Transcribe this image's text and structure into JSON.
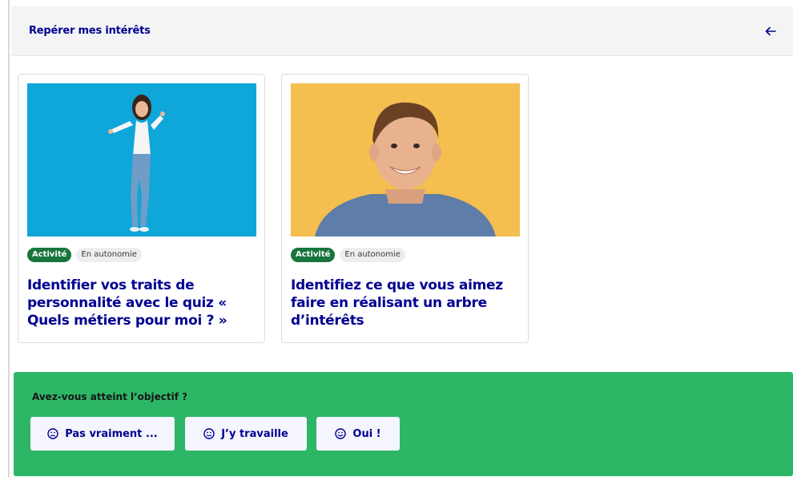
{
  "header": {
    "title": "Repérer mes intérêts",
    "back_icon": "arrow-left-icon"
  },
  "cards": [
    {
      "image": "girl-blue-background-photo",
      "badges": [
        "Activité",
        "En autonomie"
      ],
      "title": "Identifier vos traits de personnalité avec le quiz « Quels métiers pour moi ? »"
    },
    {
      "image": "boy-yellow-background-photo",
      "badges": [
        "Activité",
        "En autonomie"
      ],
      "title": "Identifiez ce que vous aimez faire en réalisant un arbre d’intérêts"
    }
  ],
  "feedback": {
    "question": "Avez-vous atteint l’objectif ?",
    "options": [
      {
        "label": "Pas vraiment ...",
        "icon": "sad-face-icon"
      },
      {
        "label": "J’y travaille",
        "icon": "neutral-face-icon"
      },
      {
        "label": "Oui !",
        "icon": "happy-face-icon"
      }
    ]
  },
  "colors": {
    "primary_blue": "#000091",
    "feedback_green": "#2eb667",
    "badge_green": "#18753c"
  }
}
